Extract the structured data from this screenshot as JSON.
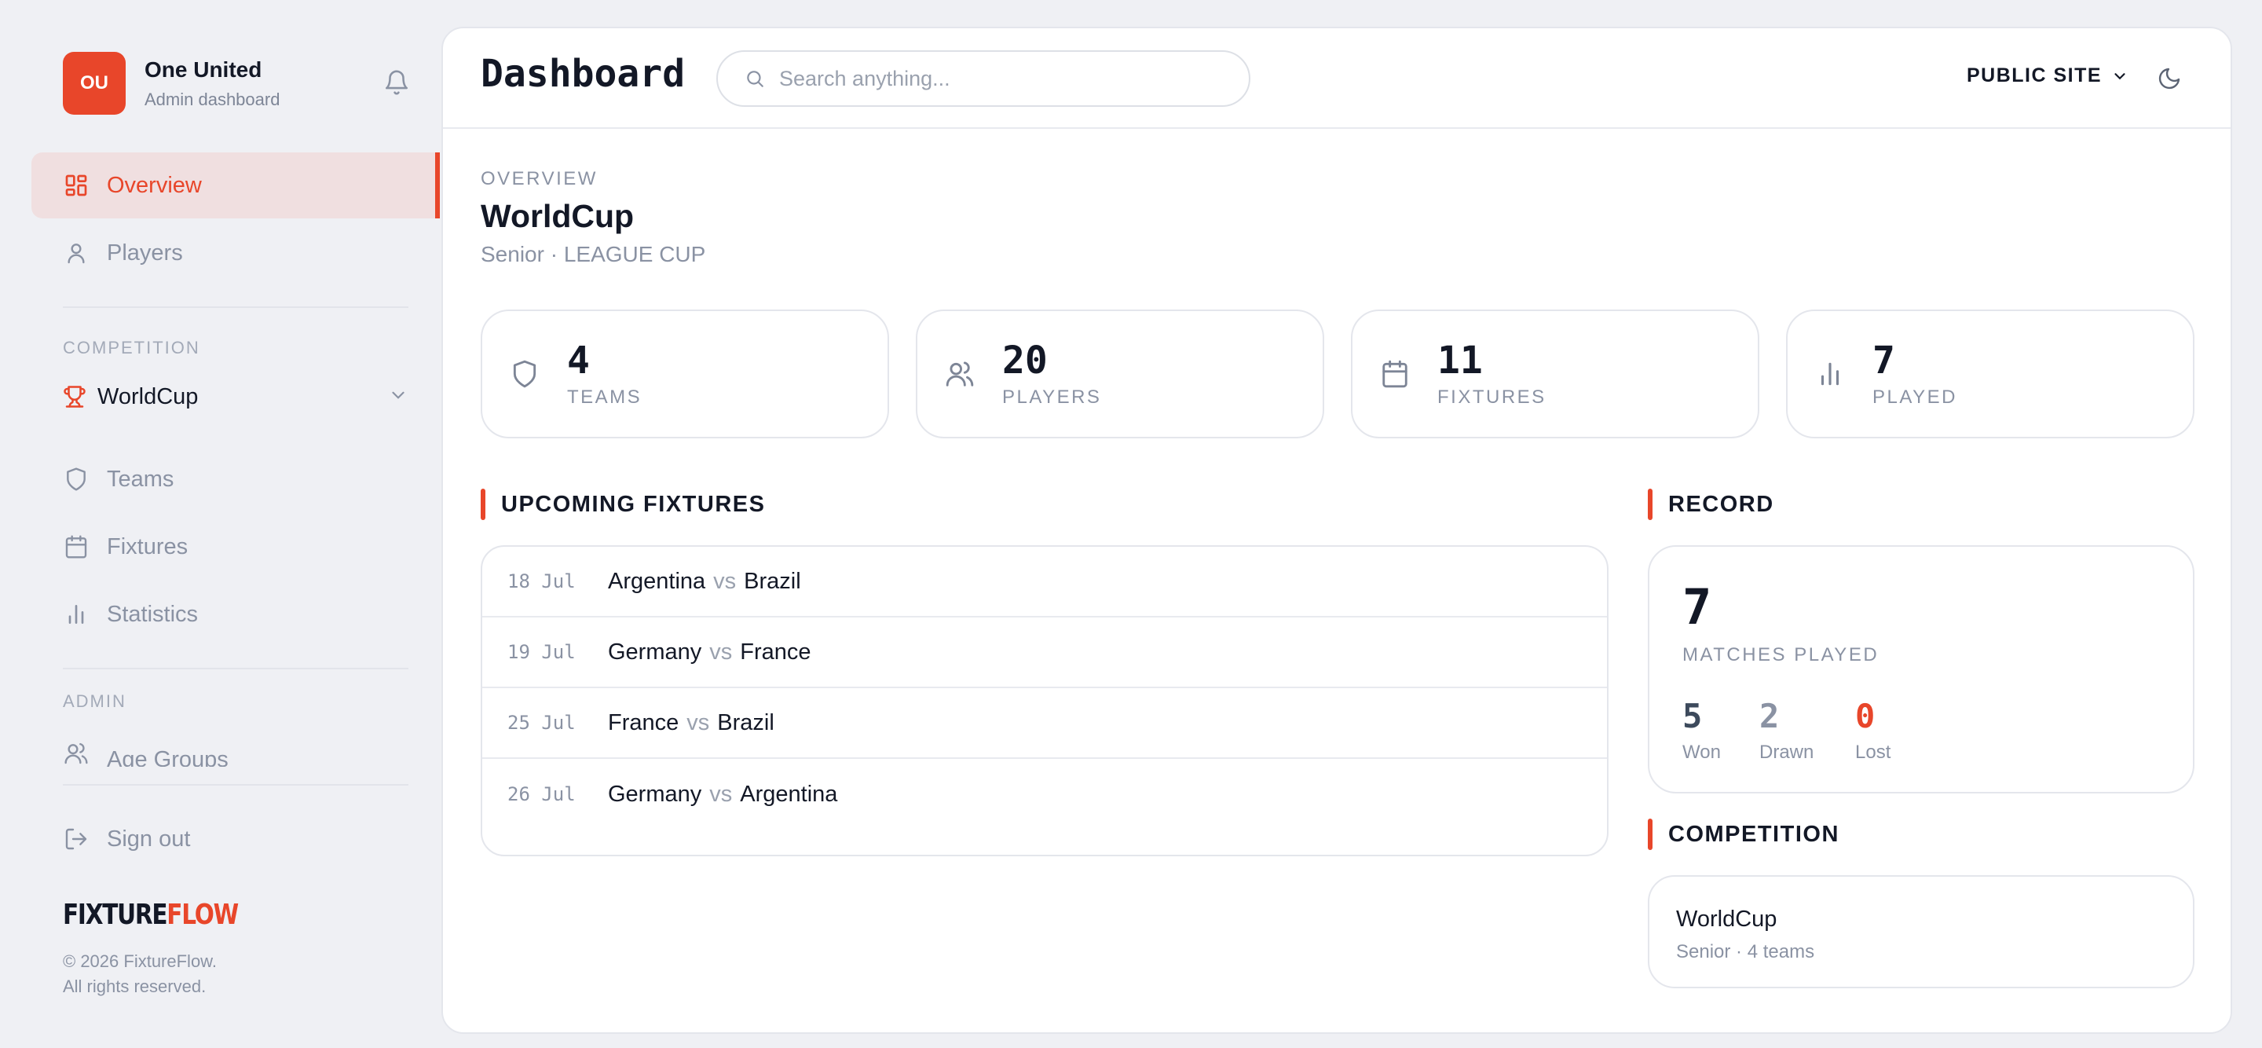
{
  "sidebar": {
    "avatar": "OU",
    "club_name": "One United",
    "club_sub": "Admin dashboard",
    "nav": [
      {
        "label": "Overview",
        "icon": "grid-icon"
      },
      {
        "label": "Players",
        "icon": "user-icon"
      }
    ],
    "competition_section": "COMPETITION",
    "competition_selected": "WorldCup",
    "competition_nav": [
      {
        "label": "Teams",
        "icon": "shield-icon"
      },
      {
        "label": "Fixtures",
        "icon": "calendar-icon"
      },
      {
        "label": "Statistics",
        "icon": "bar-chart-icon"
      }
    ],
    "admin_section": "ADMIN",
    "admin_nav": [
      {
        "label": "Age Groups",
        "icon": "users-icon"
      }
    ],
    "sign_out": "Sign out",
    "logo_part1": "FIXTURE",
    "logo_part2": "FLOW",
    "copyright_line1": "© 2026 FixtureFlow.",
    "copyright_line2": "All rights reserved."
  },
  "header": {
    "title": "Dashboard",
    "search_placeholder": "Search anything...",
    "public_site": "PUBLIC SITE"
  },
  "overview": {
    "label": "OVERVIEW",
    "title": "WorldCup",
    "subtitle": "Senior · LEAGUE CUP"
  },
  "stats": [
    {
      "value": "4",
      "label": "TEAMS",
      "icon": "shield-icon"
    },
    {
      "value": "20",
      "label": "PLAYERS",
      "icon": "users-icon"
    },
    {
      "value": "11",
      "label": "FIXTURES",
      "icon": "calendar-icon"
    },
    {
      "value": "7",
      "label": "PLAYED",
      "icon": "bar-chart-icon"
    }
  ],
  "upcoming": {
    "heading": "UPCOMING FIXTURES",
    "vs": "vs",
    "rows": [
      {
        "date": "18 Jul",
        "home": "Argentina",
        "away": "Brazil"
      },
      {
        "date": "19 Jul",
        "home": "Germany",
        "away": "France"
      },
      {
        "date": "25 Jul",
        "home": "France",
        "away": "Brazil"
      },
      {
        "date": "26 Jul",
        "home": "Germany",
        "away": "Argentina"
      }
    ]
  },
  "record": {
    "heading": "RECORD",
    "played": "7",
    "played_label": "MATCHES PLAYED",
    "won": "5",
    "won_label": "Won",
    "drawn": "2",
    "drawn_label": "Drawn",
    "lost": "0",
    "lost_label": "Lost"
  },
  "competition": {
    "heading": "COMPETITION",
    "name": "WorldCup",
    "meta": "Senior · 4 teams"
  },
  "colors": {
    "accent": "#e8462a",
    "won": "#3d4a5c",
    "drawn": "#8a92a3",
    "lost": "#e8462a"
  }
}
